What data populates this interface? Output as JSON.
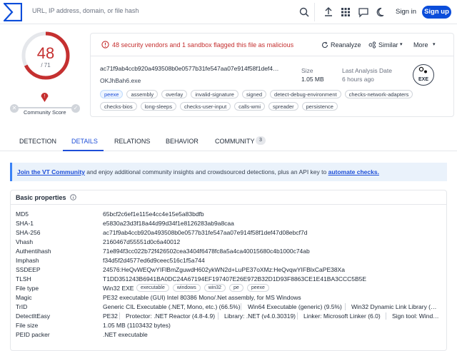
{
  "topbar": {
    "search_placeholder": "URL, IP address, domain, or file hash",
    "signin": "Sign in",
    "signup": "Sign up"
  },
  "score": {
    "detections": "48",
    "total": "/ 71",
    "fraction": 0.676,
    "community_label": "Community Score",
    "color": "#c53030"
  },
  "alert": {
    "text": "48 security vendors and 1 sandbox flagged this file as malicious",
    "reanalyze": "Reanalyze",
    "similar": "Similar",
    "more": "More"
  },
  "file": {
    "hash": "ac71f9ab4ccb920a493508b0e0577b31fe547aa07e914f58f1def4…",
    "name": "OKJhBah6.exe",
    "size_label": "Size",
    "size_value": "1.05 MB",
    "last_label": "Last Analysis Date",
    "last_value": "6 hours ago",
    "type_icon": "EXE"
  },
  "tags": [
    "peexe",
    "assembly",
    "overlay",
    "invalid-signature",
    "signed",
    "detect-debug-environment",
    "checks-network-adapters",
    "checks-bios",
    "long-sleeps",
    "checks-user-input",
    "calls-wmi",
    "spreader",
    "persistence"
  ],
  "tabs": {
    "detection": "DETECTION",
    "details": "DETAILS",
    "relations": "RELATIONS",
    "behavior": "BEHAVIOR",
    "community": "COMMUNITY",
    "community_count": "3"
  },
  "banner": {
    "link1": "Join the VT Community",
    "mid": " and enjoy additional community insights and crowdsourced detections, plus an API key to ",
    "link2": "automate checks."
  },
  "basic": {
    "title": "Basic properties",
    "md5_k": "MD5",
    "md5_v": "65bcf2c6ef1e115e4cc4e15e5a83bdfb",
    "sha1_k": "SHA-1",
    "sha1_v": "e5830a23d3f18a44d99d34f1e8126283ab9a8caa",
    "sha256_k": "SHA-256",
    "sha256_v": "ac71f9ab4ccb920a493508b0e0577b31fe547aa07e914f58f1def47d08ebcf7d",
    "vhash_k": "Vhash",
    "vhash_v": "2160467d55551d0c6a40012",
    "auth_k": "Authentihash",
    "auth_v": "71e894f3cc022b72f426502cea3404f6478fc8a5a4ca40015680c4b1000c74ab",
    "imphash_k": "Imphash",
    "imphash_v": "f34d5f2d4577ed6d9ceec516c1f5a744",
    "ssdeep_k": "SSDEEP",
    "ssdeep_v": "24576:HeQvWEQwYIFlBmZguwdH602ykWN2d+LuPE37oXMz:HeQvqwYIFBlxCaPE38Xa",
    "tlsh_k": "TLSH",
    "tlsh_v": "T1DD351243B6941BA0DC24A67194EF197407E26E972B32D1D93F8863CE1E41BA3CCC5B5E",
    "ftype_k": "File type",
    "ftype_v": "Win32 EXE",
    "ftype_tags": [
      "executable",
      "windows",
      "win32",
      "pe",
      "peexe"
    ],
    "magic_k": "Magic",
    "magic_v": "PE32 executable (GUI) Intel 80386 Mono/.Net assembly, for MS Windows",
    "trid_k": "TrID",
    "trid_1": "Generic CIL Executable (.NET, Mono, etc.) (66.5%)",
    "trid_2": "Win64 Executable (generic) (9.5%)",
    "trid_3": "Win32 Dynamic Link Library (…",
    "die_k": "DetectItEasy",
    "die_1": "PE32",
    "die_2": "Protector: .NET Reactor (4.8-4.9)",
    "die_3": "Library: .NET (v4.0.30319)",
    "die_4": "Linker: Microsoft Linker (6.0)",
    "die_5": "Sign tool: Wind…",
    "fsize_k": "File size",
    "fsize_v": "1.05 MB (1103432 bytes)",
    "peid_k": "PEID packer",
    "peid_v": ".NET executable"
  }
}
